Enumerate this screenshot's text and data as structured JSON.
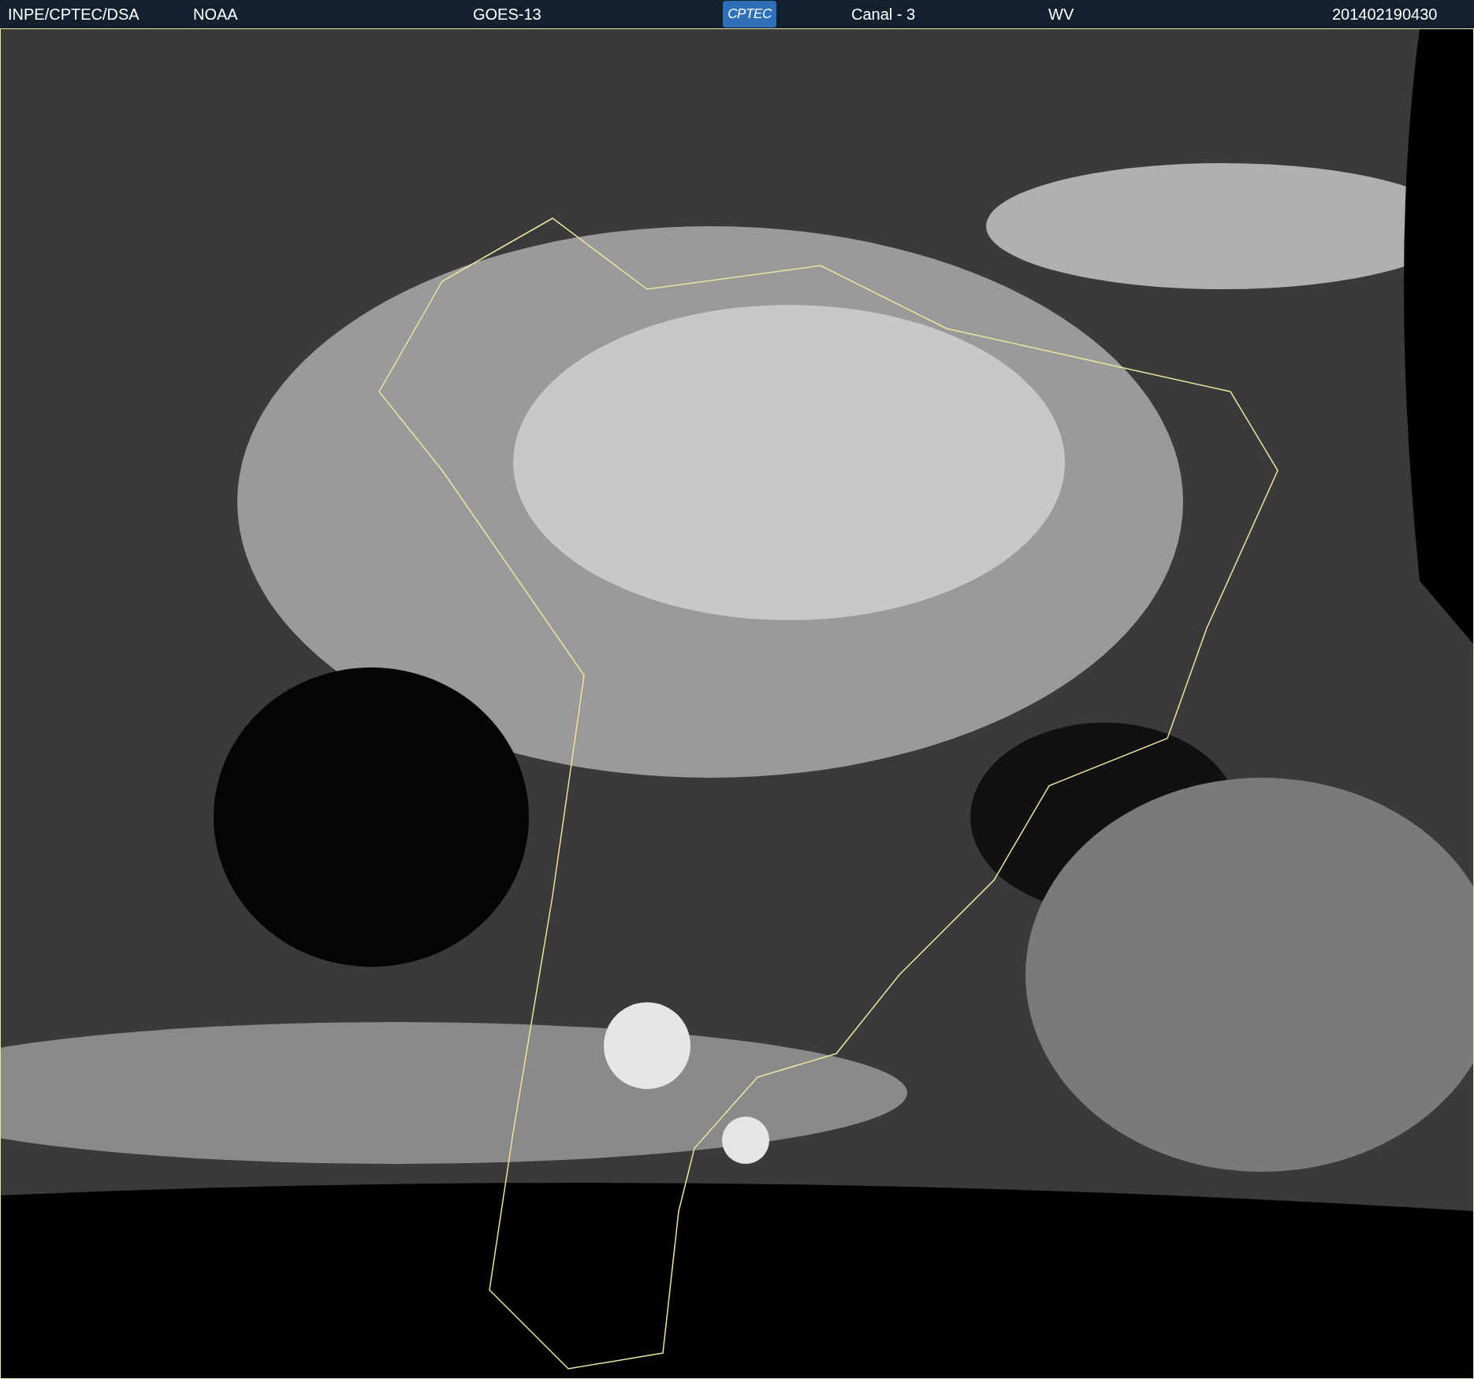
{
  "header": {
    "items": [
      {
        "kind": "text",
        "text": "INPE/CPTEC/DSA"
      },
      {
        "kind": "text",
        "text": "NOAA"
      },
      {
        "kind": "text",
        "text": "GOES-13"
      },
      {
        "kind": "logo",
        "text": "CPTEC"
      },
      {
        "kind": "text",
        "text": "Canal - 3"
      },
      {
        "kind": "text",
        "text": "WV"
      },
      {
        "kind": "text",
        "text": "201402190430"
      }
    ]
  }
}
